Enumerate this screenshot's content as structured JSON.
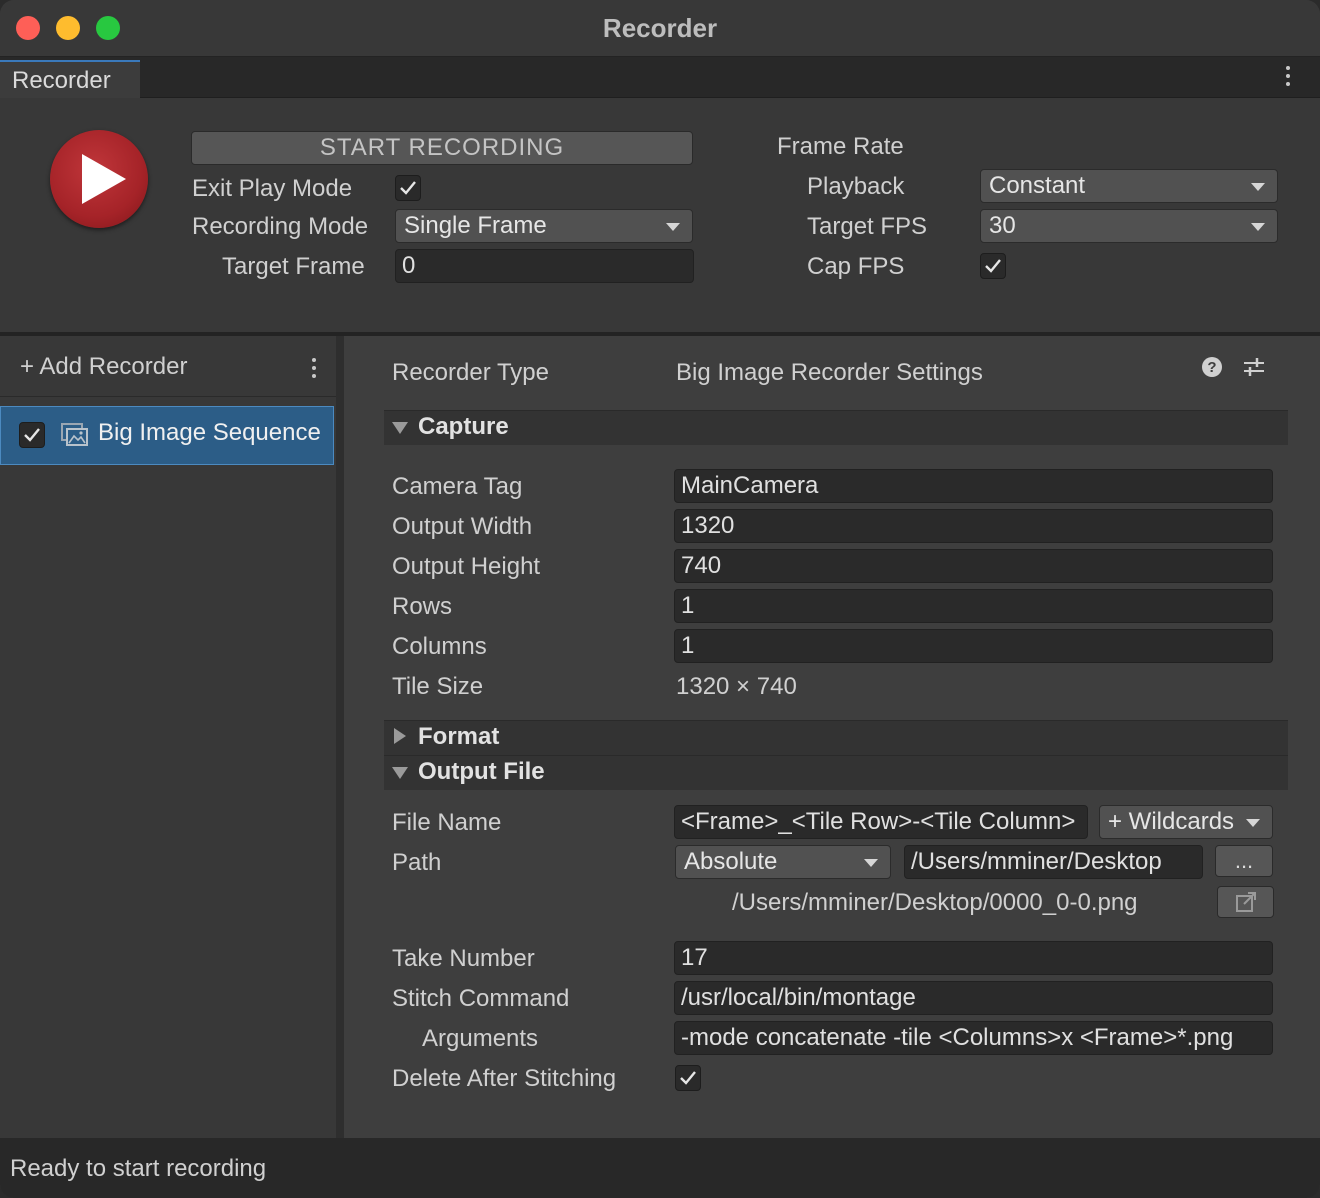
{
  "window": {
    "title": "Recorder"
  },
  "tab": {
    "label": "Recorder"
  },
  "top": {
    "start_label": "START RECORDING",
    "exit_play_mode_label": "Exit Play Mode",
    "exit_play_mode_checked": true,
    "recording_mode_label": "Recording Mode",
    "recording_mode_value": "Single Frame",
    "target_frame_label": "Target Frame",
    "target_frame_value": "0",
    "frame_rate_label": "Frame Rate",
    "playback_label": "Playback",
    "playback_value": "Constant",
    "target_fps_label": "Target FPS",
    "target_fps_value": "30",
    "cap_fps_label": "Cap FPS",
    "cap_fps_checked": true
  },
  "sidebar": {
    "add_label": "+ Add Recorder",
    "items": [
      {
        "label": "Big Image Sequence",
        "enabled": true
      }
    ]
  },
  "settings": {
    "recorder_type_label": "Recorder Type",
    "recorder_type_value": "Big Image Recorder Settings",
    "capture": {
      "title": "Capture",
      "camera_tag_label": "Camera Tag",
      "camera_tag_value": "MainCamera",
      "output_width_label": "Output Width",
      "output_width_value": "1320",
      "output_height_label": "Output Height",
      "output_height_value": "740",
      "rows_label": "Rows",
      "rows_value": "1",
      "columns_label": "Columns",
      "columns_value": "1",
      "tile_size_label": "Tile Size",
      "tile_size_value": "1320 × 740"
    },
    "format": {
      "title": "Format"
    },
    "output_file": {
      "title": "Output File",
      "file_name_label": "File Name",
      "file_name_value": "<Frame>_<Tile Row>-<Tile Column>",
      "wildcards_label": "+ Wildcards",
      "path_label": "Path",
      "path_mode_value": "Absolute",
      "path_value": "/Users/mminer/Desktop",
      "browse_label": "...",
      "resolved_path": "/Users/mminer/Desktop/0000_0-0.png",
      "take_number_label": "Take Number",
      "take_number_value": "17",
      "stitch_command_label": "Stitch Command",
      "stitch_command_value": "/usr/local/bin/montage",
      "arguments_label": "Arguments",
      "arguments_value": "-mode concatenate -tile <Columns>x <Frame>*.png",
      "delete_after_label": "Delete After Stitching",
      "delete_after_checked": true
    }
  },
  "status": {
    "text": "Ready to start recording"
  },
  "icons": [
    "play-icon",
    "kebab-menu-icon",
    "checkmark-icon",
    "image-sequence-icon",
    "help-icon",
    "preset-sliders-icon",
    "reveal-folder-icon"
  ],
  "colors": {
    "accent": "#2c5d87",
    "record": "#a52328"
  }
}
